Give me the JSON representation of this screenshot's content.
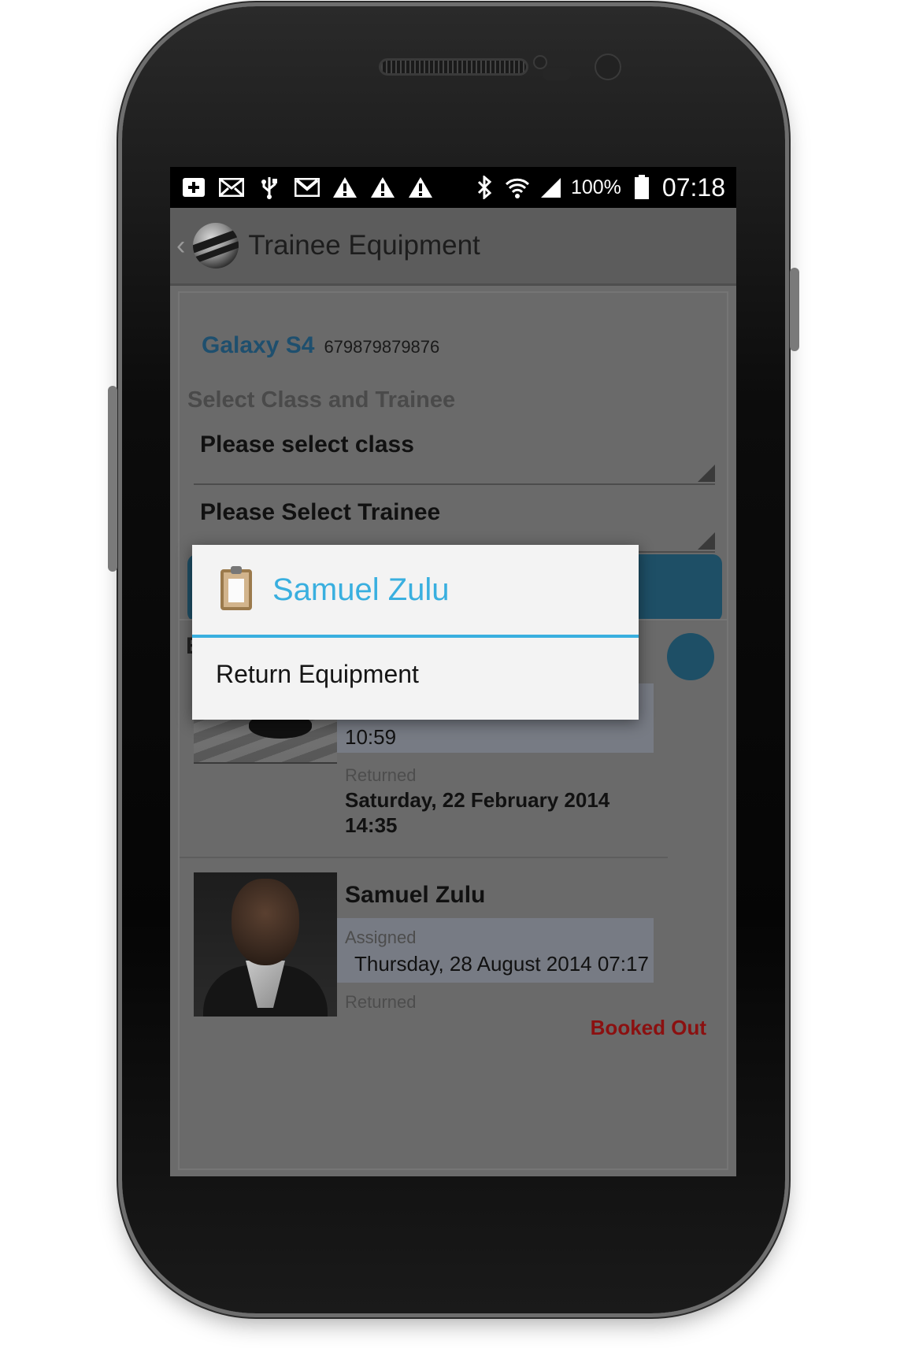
{
  "status_bar": {
    "battery": "100%",
    "time": "07:18",
    "left_icons": [
      "plus-box-icon",
      "email-icon",
      "usb-icon",
      "gmail-icon",
      "warning-icon",
      "warning-icon",
      "warning-icon"
    ],
    "right_icons": [
      "bluetooth-icon",
      "wifi-icon",
      "signal-icon",
      "battery-icon"
    ]
  },
  "action_bar": {
    "title": "Trainee Equipment"
  },
  "equipment": {
    "name": "Galaxy S4",
    "serial": "679879879876"
  },
  "form": {
    "section_label": "Select Class and Trainee",
    "class_spinner": "Please select class",
    "trainee_spinner": "Please Select Trainee"
  },
  "list": {
    "header_visible": "Ec",
    "items": [
      {
        "assigned_time_visible": "10:59",
        "returned_label": "Returned",
        "returned_value": "Saturday, 22 February 2014\n14:35"
      },
      {
        "name": "Samuel Zulu",
        "assigned_label": "Assigned",
        "assigned_value": "Thursday, 28 August 2014 07:17",
        "returned_label": "Returned",
        "status": "Booked Out"
      }
    ]
  },
  "dialog": {
    "title": "Samuel Zulu",
    "icon": "clipboard-icon",
    "items": [
      "Return Equipment"
    ]
  },
  "colors": {
    "accent_blue": "#39afdf",
    "device_name_blue": "#1e4f6e",
    "button_teal": "#1e4f66",
    "status_red": "#8b1010"
  }
}
